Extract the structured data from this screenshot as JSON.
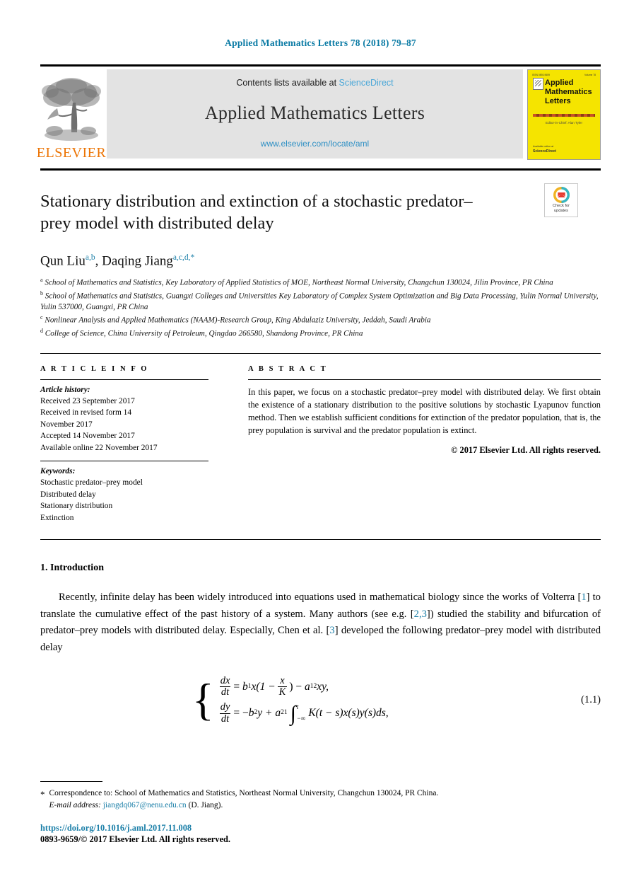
{
  "running_head": "Applied Mathematics Letters 78 (2018) 79–87",
  "masthead": {
    "publisher_name": "ELSEVIER",
    "contents_prefix": "Contents lists available at ",
    "contents_link": "ScienceDirect",
    "journal_title": "Applied Mathematics Letters",
    "journal_url": "www.elsevier.com/locate/aml",
    "cover": {
      "top_left": "ISSN 0893-9659",
      "top_right": "Volume 78",
      "title_line1": "Applied",
      "title_line2": "Mathematics",
      "title_line3": "Letters",
      "subtitle": "Editor-in-Chief: Alan Tyler",
      "foot_small": "Available online at",
      "foot_brand": "ScienceDirect"
    }
  },
  "article": {
    "title": "Stationary distribution and extinction of a stochastic predator–prey model with distributed delay",
    "crossmark_line1": "Check for",
    "crossmark_line2": "updates",
    "authors_plain": "Qun Liu, Daqing Jiang",
    "author1_name": "Qun Liu",
    "author1_sup": "a,b",
    "author_sep": ", ",
    "author2_name": "Daqing Jiang",
    "author2_sup": "a,c,d,*",
    "affiliations": [
      {
        "mark": "a",
        "text": "School of Mathematics and Statistics, Key Laboratory of Applied Statistics of MOE, Northeast Normal University, Changchun 130024, Jilin Province, PR China"
      },
      {
        "mark": "b",
        "text": "School of Mathematics and Statistics, Guangxi Colleges and Universities Key Laboratory of Complex System Optimization and Big Data Processing, Yulin Normal University, Yulin 537000, Guangxi, PR China"
      },
      {
        "mark": "c",
        "text": "Nonlinear Analysis and Applied Mathematics (NAAM)-Research Group, King Abdulaziz University, Jeddah, Saudi Arabia"
      },
      {
        "mark": "d",
        "text": "College of Science, China University of Petroleum, Qingdao 266580, Shandong Province, PR China"
      }
    ]
  },
  "article_info": {
    "heading": "A R T I C L E   I N F O",
    "history_label": "Article history:",
    "history": [
      "Received 23 September 2017",
      "Received in revised form 14",
      "November 2017",
      "Accepted 14 November 2017",
      "Available online 22 November 2017"
    ],
    "keywords_label": "Keywords:",
    "keywords": [
      "Stochastic predator–prey model",
      "Distributed delay",
      "Stationary distribution",
      "Extinction"
    ]
  },
  "abstract": {
    "heading": "A B S T R A C T",
    "text": "In this paper, we focus on a stochastic predator–prey model with distributed delay. We first obtain the existence of a stationary distribution to the positive solutions by stochastic Lyapunov function method. Then we establish sufficient conditions for extinction of the predator population, that is, the prey population is survival and the predator population is extinct.",
    "copyright": "© 2017 Elsevier Ltd. All rights reserved."
  },
  "introduction": {
    "heading": "1.  Introduction",
    "part1": "Recently, infinite delay has been widely introduced into equations used in mathematical biology since the works of Volterra [",
    "cite1": "1",
    "part2": "] to translate the cumulative effect of the past history of a system. Many authors (see e.g. [",
    "cite2": "2,3",
    "part3": "]) studied the stability and bifurcation of predator–prey models with distributed delay. Especially, Chen et al. [",
    "cite3": "3",
    "part4": "] developed the following predator–prey model with distributed delay"
  },
  "equation": {
    "number": "(1.1)",
    "line1": {
      "lhs_num": "dx",
      "lhs_den": "dt",
      "eq": "=",
      "b": "b",
      "b_sub": "1",
      "x1": "x(1 −",
      "frac_num": "x",
      "frac_den": "K",
      "close": ") −",
      "a": "a",
      "a_sub": "12",
      "tail": "xy,"
    },
    "line2": {
      "lhs_num": "dy",
      "lhs_den": "dt",
      "eq": "= −",
      "b": "b",
      "b_sub": "2",
      "y": "y +",
      "a": "a",
      "a_sub": "21",
      "int_hi": "t",
      "int_lo": "−∞",
      "tail": "K(t − s)x(s)y(s)ds,"
    }
  },
  "footnotes": {
    "mark": "*",
    "correspondence": "Correspondence to: School of Mathematics and Statistics, Northeast Normal University, Changchun 130024, PR China.",
    "email_label": "E-mail address:",
    "email": "jiangdq067@nenu.edu.cn",
    "email_owner": "(D. Jiang).",
    "doi": "https://doi.org/10.1016/j.aml.2017.11.008",
    "issn_line": "0893-9659/© 2017 Elsevier Ltd. All rights reserved."
  },
  "colors": {
    "link_blue": "#1b7fa8",
    "header_blue": "#0b7ba5",
    "elsevier_orange": "#ec7404",
    "cover_yellow": "#f5e400"
  }
}
